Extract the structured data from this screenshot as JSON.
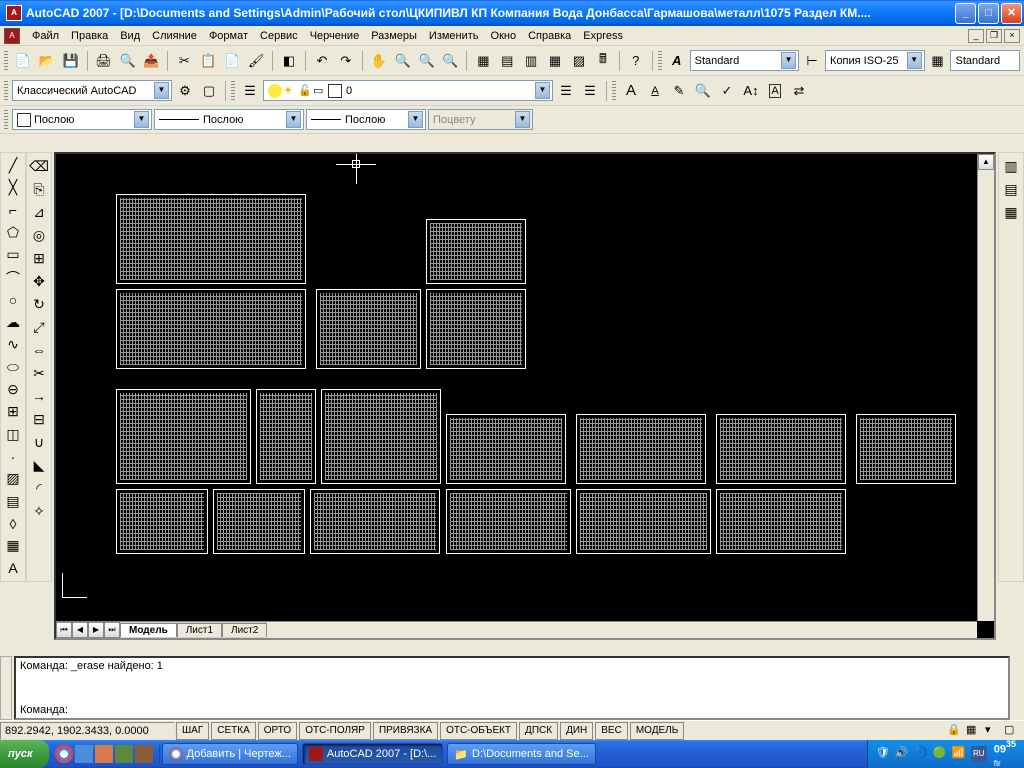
{
  "titlebar": {
    "text": "AutoCAD 2007 - [D:\\Documents and Settings\\Admin\\Рабочий стол\\ЦКИПИВЛ КП Компания Вода Донбасса\\Гармашова\\металл\\1075 Раздел  КМ...."
  },
  "menu": {
    "items": [
      "Файл",
      "Правка",
      "Вид",
      "Слияние",
      "Формат",
      "Сервис",
      "Черчение",
      "Размеры",
      "Изменить",
      "Окно",
      "Справка",
      "Express"
    ]
  },
  "toolbars": {
    "text_style": "Standard",
    "dim_style": "Копия ISO-25",
    "tbl_style": "Standard",
    "workspace": "Классический AutoCAD",
    "layer_current": "0",
    "color": "Послою",
    "linetype": "Послою",
    "lineweight": "Послою",
    "plot_style": "Поцвету"
  },
  "layout_tabs": {
    "model": "Модель",
    "l1": "Лист1",
    "l2": "Лист2"
  },
  "command": {
    "line1": "Команда: _erase найдено: 1",
    "line2": "",
    "prompt": "Команда:"
  },
  "status": {
    "coords": "892.2942, 1902.3433, 0.0000",
    "buttons": [
      "ШАГ",
      "СЕТКА",
      "ОРТО",
      "ОТС-ПОЛЯР",
      "ПРИВЯЗКА",
      "ОТС-ОБЪЕКТ",
      "ДПСК",
      "ДИН",
      "ВЕС",
      "МОДЕЛЬ"
    ]
  },
  "taskbar": {
    "start": "пуск",
    "task1": "Добавить | Чертеж...",
    "task2": "AutoCAD 2007 - [D:\\...",
    "task3": "D:\\Documents and Se...",
    "clock": "09",
    "clock_min": "35",
    "clock_sub": "ftr"
  }
}
